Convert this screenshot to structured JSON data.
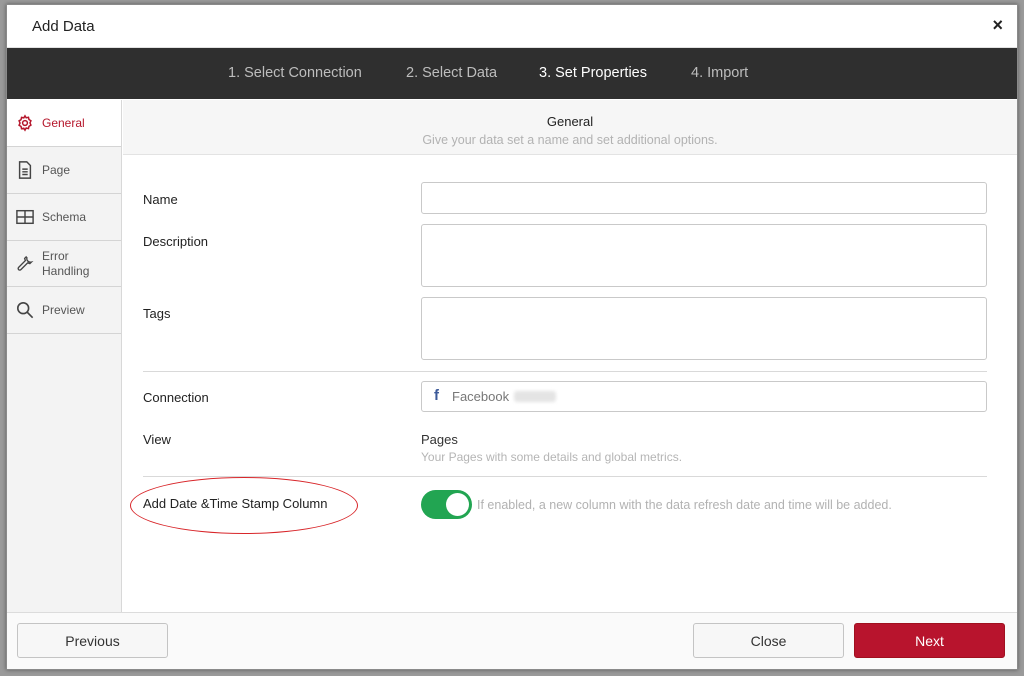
{
  "dialog": {
    "title": "Add Data",
    "close_glyph": "×"
  },
  "steps": [
    {
      "label": "1. Select Connection",
      "active": false
    },
    {
      "label": "2. Select Data",
      "active": false
    },
    {
      "label": "3. Set Properties",
      "active": true
    },
    {
      "label": "4. Import",
      "active": false
    }
  ],
  "sidebar": {
    "items": [
      {
        "label": "General",
        "icon": "gear-icon",
        "active": true
      },
      {
        "label": "Page",
        "icon": "document-icon",
        "active": false
      },
      {
        "label": "Schema",
        "icon": "table-icon",
        "active": false
      },
      {
        "label": "Error Handling",
        "label_line1": "Error",
        "label_line2": "Handling",
        "icon": "wrench-icon",
        "active": false
      },
      {
        "label": "Preview",
        "icon": "search-icon",
        "active": false
      }
    ]
  },
  "section": {
    "title": "General",
    "subtitle": "Give your data set a name and set additional options."
  },
  "form": {
    "name_label": "Name",
    "name_value": "",
    "description_label": "Description",
    "description_value": "",
    "tags_label": "Tags",
    "tags_value": "",
    "connection_label": "Connection",
    "connection_value": "Facebook",
    "view_label": "View",
    "view_value": "Pages",
    "view_description": "Your Pages with some details and global metrics.",
    "timestamp_label": "Add Date &Time Stamp Column",
    "timestamp_enabled": true,
    "timestamp_help": "If enabled, a new column with the data refresh date and time will be added."
  },
  "footer": {
    "previous_label": "Previous",
    "close_label": "Close",
    "next_label": "Next"
  },
  "colors": {
    "accent": "#b8142d",
    "toggle_on": "#22a552",
    "steps_bar": "#2f2f2f",
    "annotation": "#d8262a"
  }
}
